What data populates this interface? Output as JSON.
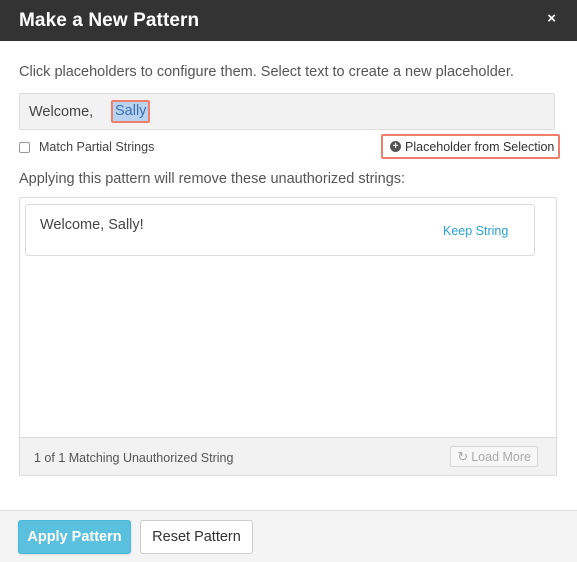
{
  "dialog": {
    "title": "Make a New Pattern",
    "close_icon": "×"
  },
  "instructions": "Click placeholders to configure them. Select text to create a new placeholder.",
  "pattern": {
    "prefix": "Welcome,",
    "placeholder": "Sally"
  },
  "match_partial": {
    "label": "Match Partial Strings",
    "checked": false
  },
  "placeholder_button": {
    "icon": "plus-circle-icon",
    "label": "Placeholder from Selection"
  },
  "applying_text": "Applying this pattern will remove these unauthorized strings:",
  "strings": [
    {
      "text": "Welcome, Sally!",
      "action": "Keep String"
    }
  ],
  "panel_footer": {
    "count_text": "1 of 1 Matching Unauthorized String",
    "load_more_label": "Load More",
    "load_more_icon": "refresh-icon"
  },
  "footer": {
    "apply_label": "Apply Pattern",
    "reset_label": "Reset Pattern"
  },
  "colors": {
    "header_bg": "#333333",
    "accent": "#5bc0de",
    "highlight_border": "#ef7f6a",
    "link": "#2a9fd6",
    "selection": "#b8d3f0"
  }
}
